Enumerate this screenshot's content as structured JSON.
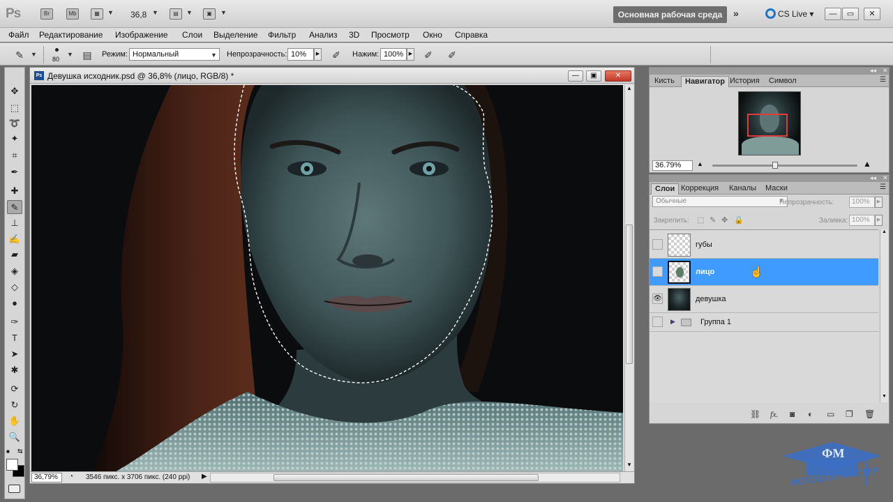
{
  "appbar": {
    "logo": "Ps",
    "bridge_label": "Br",
    "minibridge_label": "Mb",
    "zoom_value": "36,8",
    "workspace_label": "Основная рабочая среда",
    "cslive_label": "CS Live"
  },
  "menu": [
    "Файл",
    "Редактирование",
    "Изображение",
    "Слои",
    "Выделение",
    "Фильтр",
    "Анализ",
    "3D",
    "Просмотр",
    "Окно",
    "Справка"
  ],
  "options": {
    "brush_size": "80",
    "mode_label": "Режим:",
    "mode_value": "Нормальный",
    "opacity_label": "Непрозрачность:",
    "opacity_value": "10%",
    "flow_label": "Нажим:",
    "flow_value": "100%"
  },
  "document": {
    "title": "Девушка исходник.psd @ 36,8% (лицо, RGB/8) *",
    "status_zoom": "36,79%",
    "status_info": "3546 пикс. x 3706 пикс. (240 ppi)"
  },
  "navigator_panel": {
    "tabs": [
      "Кисть",
      "Навигатор",
      "История",
      "Символ"
    ],
    "active_tab": "Навигатор",
    "zoom_value": "36.79%"
  },
  "layers_panel": {
    "tabs": [
      "Слои",
      "Коррекция",
      "Каналы",
      "Маски"
    ],
    "active_tab": "Слои",
    "blend_mode": "Обычные",
    "opacity_label": "Непрозрачность:",
    "opacity_value": "100%",
    "lock_label": "Закрепить:",
    "fill_label": "Заливка:",
    "fill_value": "100%",
    "layers": [
      {
        "name": "губы",
        "visible": false,
        "selected": false
      },
      {
        "name": "лицо",
        "visible": false,
        "selected": true
      },
      {
        "name": "девушка",
        "visible": true,
        "selected": false
      },
      {
        "name": "Группа 1",
        "visible": false,
        "selected": false,
        "group": true
      }
    ],
    "eye_glyph": "👁"
  },
  "watermark": {
    "text": "ФОТОШОП МАСТЕР",
    "badge": "ФМ"
  },
  "colors": {
    "selected_layer": "#3f9bff",
    "workspace_button": "#6e6e6e",
    "navigator_frame": "#e23b3b"
  }
}
